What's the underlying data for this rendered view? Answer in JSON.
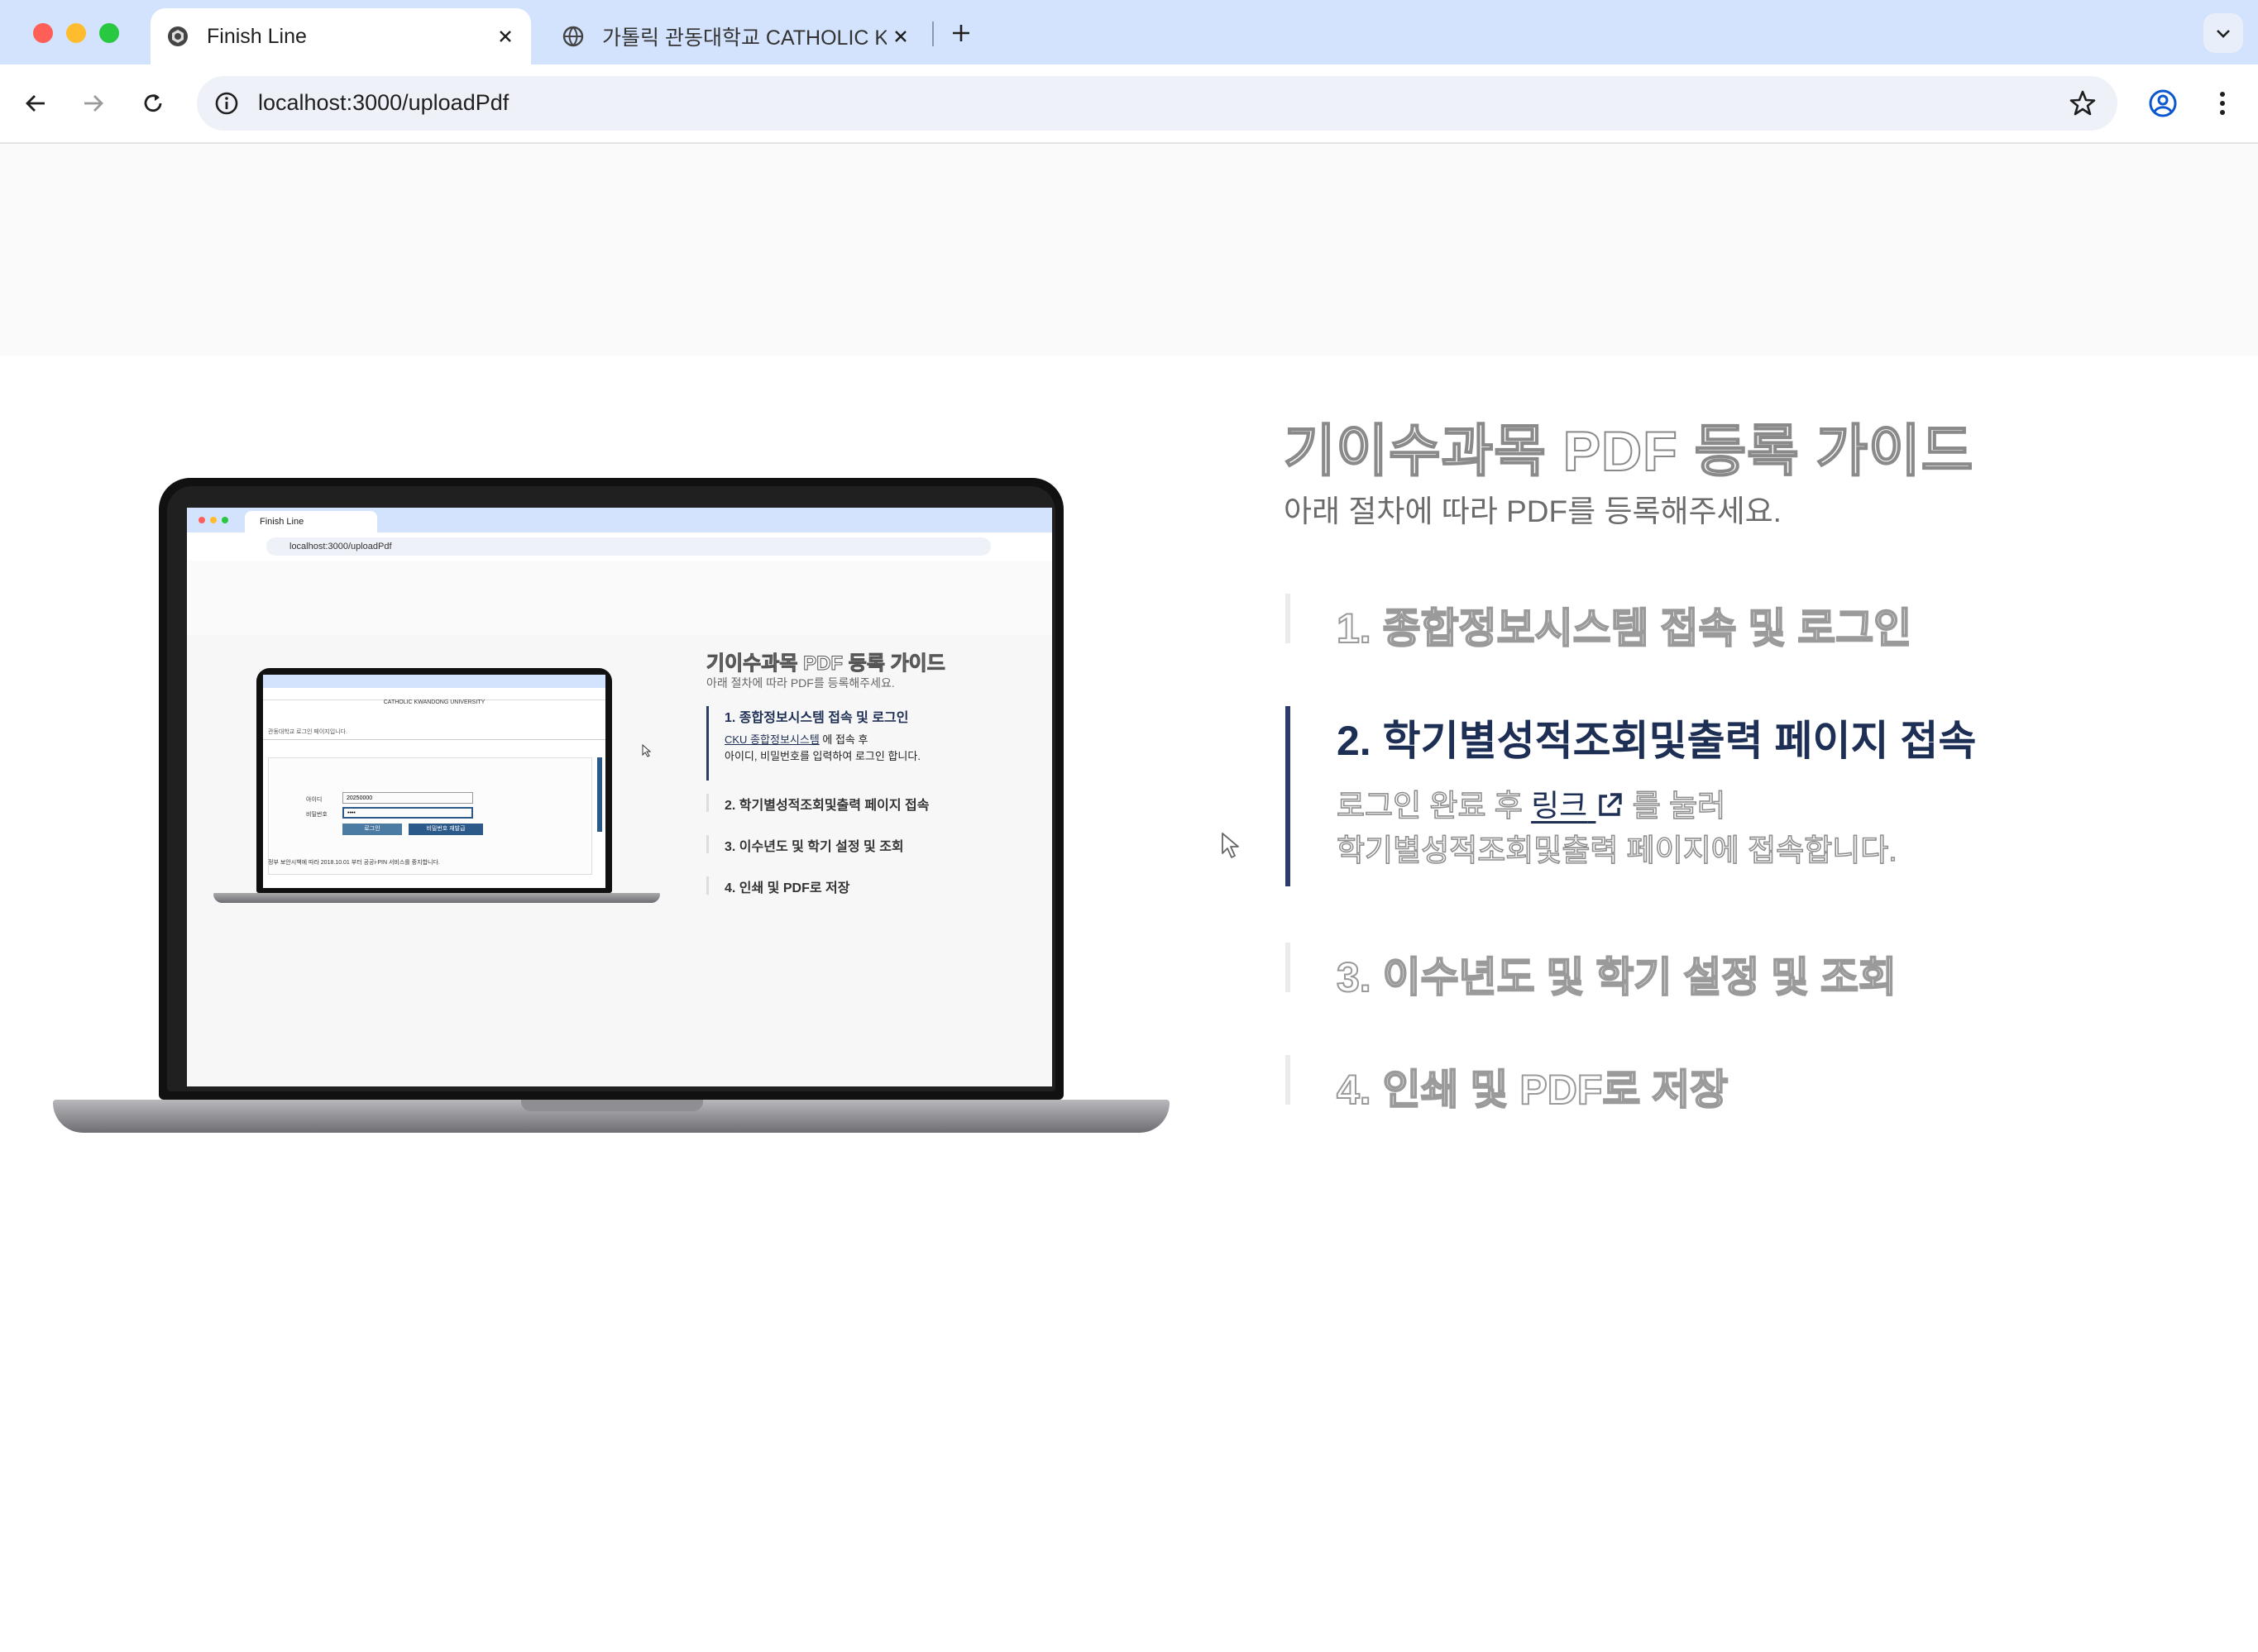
{
  "browser": {
    "tabs": [
      {
        "title": "Finish Line",
        "active": true,
        "icon": "app-logo-icon"
      },
      {
        "title": "가톨릭 관동대학교 CATHOLIC KWANDONG",
        "active": false,
        "icon": "globe-icon"
      }
    ],
    "address_bar": {
      "url": "localhost:3000/uploadPdf"
    }
  },
  "page": {
    "title": "기이수과목 PDF 등록 가이드",
    "subtitle": "아래 절차에 따라 PDF를 등록해주세요.",
    "steps": [
      {
        "label": "1. 종합정보시스템 접속 및 로그인",
        "active": false
      },
      {
        "label": "2. 학기별성적조회및출력 페이지 접속",
        "active": true,
        "desc_prefix": "로그인 완료 후 ",
        "link_text": "링크",
        "desc_suffix": " 를 눌러",
        "desc_line2": "학기별성적조회및출력 페이지에 접속합니다."
      },
      {
        "label": "3. 이수년도 및 학기 설정 및 조회",
        "active": false
      },
      {
        "label": "4. 인쇄 및 PDF로 저장",
        "active": false
      }
    ]
  },
  "mockup": {
    "tab_title": "Finish Line",
    "url": "localhost:3000/uploadPdf",
    "title": "기이수과목 PDF 등록 가이드",
    "subtitle": "아래 절차에 따라 PDF를 등록해주세요.",
    "step1": "1. 종합정보시스템 접속 및 로그인",
    "step1_link": "CKU 종합정보시스템",
    "step1_line1_suffix": " 에 접속 후",
    "step1_line2": "아이디, 비밀번호를 입력하여 로그인 합니다.",
    "step2": "2. 학기별성적조회및출력 페이지 접속",
    "step3": "3. 이수년도 및 학기 설정 및 조회",
    "step4": "4. 인쇄 및 PDF로 저장",
    "nested": {
      "heading": "CATHOLIC KWANDONG UNIVERSITY",
      "login_notice": "관동대학교 로그인 페이지입니다.",
      "id_label": "아이디",
      "id_value": "20250000",
      "pw_label": "비밀번호",
      "pw_value": "••••",
      "login_button": "로그인",
      "reset_button": "비밀번호 재발급",
      "footer": "정부 보안시책에 따라 2018.10.01 부터 공공i-PIN 서비스를 중지합니다."
    }
  },
  "colors": {
    "accent": "#1e2f55",
    "tabbar": "#d3e3fd",
    "active_bar": "#2a3c68"
  }
}
